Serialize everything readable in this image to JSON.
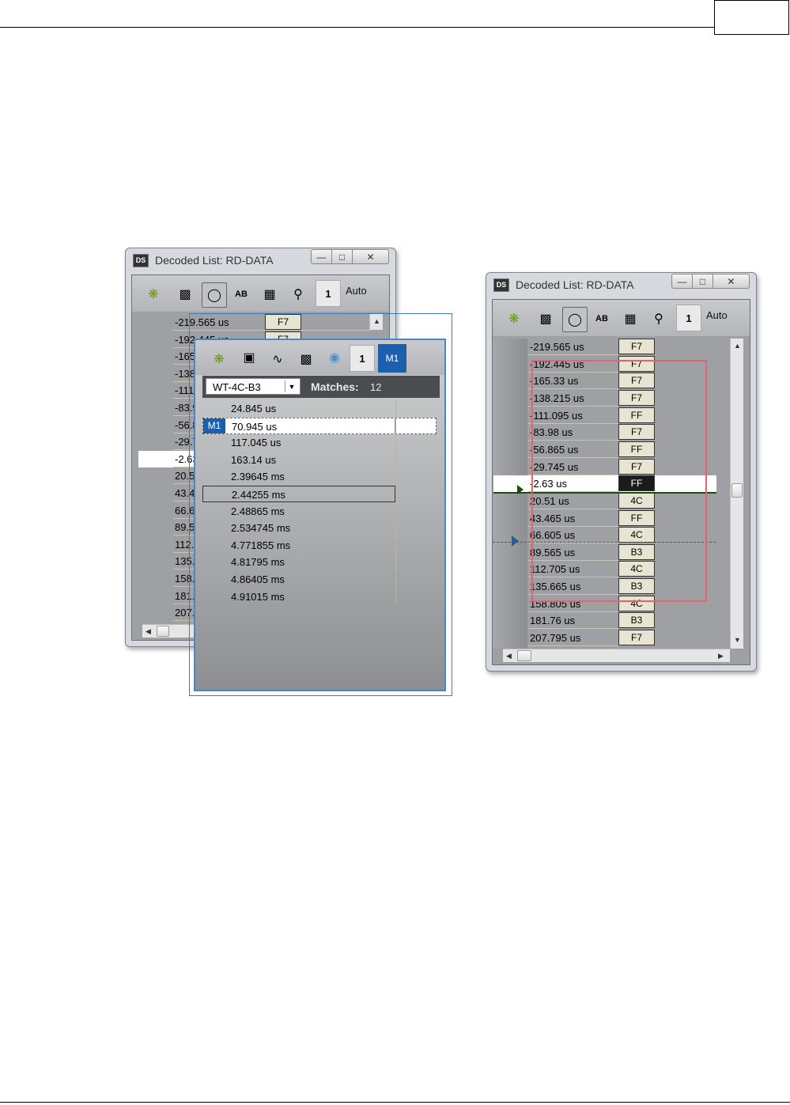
{
  "page": {
    "header_box_text": ""
  },
  "left_window": {
    "title": "Decoded List: RD-DATA",
    "app_icon": "DS",
    "toolbar": {
      "num": "1",
      "auto": "Auto",
      "icons": [
        "gear-icon",
        "export-icon",
        "marker-icon",
        "ab-icon",
        "view-icon",
        "in-out-icon"
      ]
    },
    "rows": [
      {
        "time": "-219.565 us",
        "value": "F7"
      },
      {
        "time": "-192.445 us",
        "value": "F7"
      },
      {
        "time": "-165",
        "value": ""
      },
      {
        "time": "-138",
        "value": ""
      },
      {
        "time": "-111",
        "value": ""
      },
      {
        "time": "-83.9",
        "value": ""
      },
      {
        "time": "-56.8",
        "value": ""
      },
      {
        "time": "-29.7",
        "value": ""
      },
      {
        "time": "-2.63",
        "value": ""
      },
      {
        "time": "20.5",
        "value": ""
      },
      {
        "time": "43.4",
        "value": ""
      },
      {
        "time": "66.6",
        "value": ""
      },
      {
        "time": "89.5",
        "value": ""
      },
      {
        "time": "112.",
        "value": ""
      },
      {
        "time": "135.",
        "value": ""
      },
      {
        "time": "158.",
        "value": ""
      },
      {
        "time": "181.",
        "value": ""
      },
      {
        "time": "207.",
        "value": ""
      }
    ]
  },
  "search_panel": {
    "toolbar": {
      "num": "1",
      "marker": "M1",
      "icons": [
        "gear-icon",
        "window-icon",
        "wave-icon",
        "export-icon",
        "bulb-icon"
      ]
    },
    "pattern": "WT-4C-B3",
    "matches_label": "Matches:",
    "matches_count": "12",
    "items": [
      {
        "marker": "",
        "time": "24.845 us"
      },
      {
        "marker": "M1",
        "time": "70.945 us"
      },
      {
        "marker": "",
        "time": "117.045 us"
      },
      {
        "marker": "",
        "time": "163.14 us"
      },
      {
        "marker": "",
        "time": "2.39645 ms"
      },
      {
        "marker": "",
        "time": "2.44255 ms"
      },
      {
        "marker": "",
        "time": "2.48865 ms"
      },
      {
        "marker": "",
        "time": "2.534745 ms"
      },
      {
        "marker": "",
        "time": "4.771855 ms"
      },
      {
        "marker": "",
        "time": "4.81795 ms"
      },
      {
        "marker": "",
        "time": "4.86405 ms"
      },
      {
        "marker": "",
        "time": "4.91015 ms"
      }
    ]
  },
  "right_window": {
    "title": "Decoded List: RD-DATA",
    "app_icon": "DS",
    "toolbar": {
      "num": "1",
      "auto": "Auto",
      "icons": [
        "gear-icon",
        "export-icon",
        "marker-icon",
        "ab-icon",
        "view-icon",
        "in-out-icon"
      ]
    },
    "rows": [
      {
        "time": "-219.565 us",
        "value": "F7"
      },
      {
        "time": "-192.445 us",
        "value": "F7"
      },
      {
        "time": "-165.33 us",
        "value": "F7"
      },
      {
        "time": "-138.215 us",
        "value": "F7"
      },
      {
        "time": "-111.095 us",
        "value": "FF"
      },
      {
        "time": "-83.98 us",
        "value": "F7"
      },
      {
        "time": "-56.865 us",
        "value": "FF"
      },
      {
        "time": "-29.745 us",
        "value": "F7"
      },
      {
        "time": "-2.63 us",
        "value": "FF"
      },
      {
        "time": "20.51 us",
        "value": "4C"
      },
      {
        "time": "43.465 us",
        "value": "FF"
      },
      {
        "time": "66.605 us",
        "value": "4C"
      },
      {
        "time": "89.565 us",
        "value": "B3"
      },
      {
        "time": "112.705 us",
        "value": "4C"
      },
      {
        "time": "135.665 us",
        "value": "B3"
      },
      {
        "time": "158.805 us",
        "value": "4C"
      },
      {
        "time": "181.76 us",
        "value": "B3"
      },
      {
        "time": "207.795 us",
        "value": "F7"
      }
    ]
  }
}
